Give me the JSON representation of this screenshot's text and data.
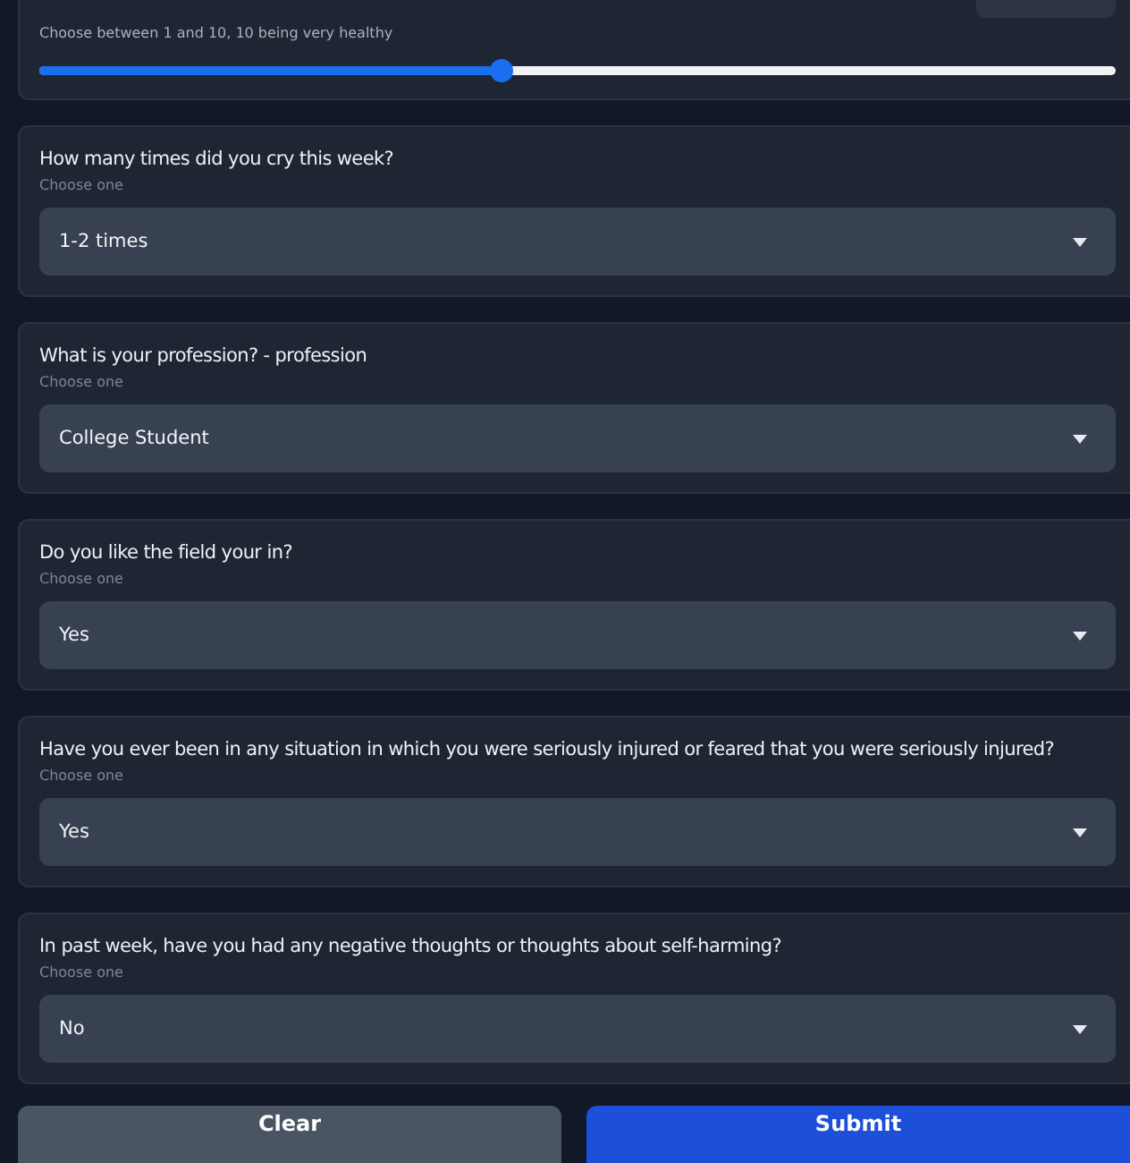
{
  "slider": {
    "hint": "Choose between 1 and 10, 10 being very healthy",
    "level": 0.43
  },
  "questions": [
    {
      "label": "How many times did you cry this week?",
      "hint": "Choose one",
      "value": "1-2 times"
    },
    {
      "label": "What is your profession? - profession",
      "hint": "Choose one",
      "value": "College Student"
    },
    {
      "label": "Do you like the field your in?",
      "hint": "Choose one",
      "value": "Yes"
    },
    {
      "label": "Have you ever been in any situation in which you were seriously injured or feared that you were seriously injured?",
      "hint": "Choose one",
      "value": "Yes"
    },
    {
      "label": "In past week, have you had any negative thoughts or thoughts about self-harming?",
      "hint": "Choose one",
      "value": "No"
    }
  ],
  "buttons": [
    {
      "label": "Clear",
      "kind": "secondary"
    },
    {
      "label": "Submit",
      "kind": "primary"
    }
  ]
}
